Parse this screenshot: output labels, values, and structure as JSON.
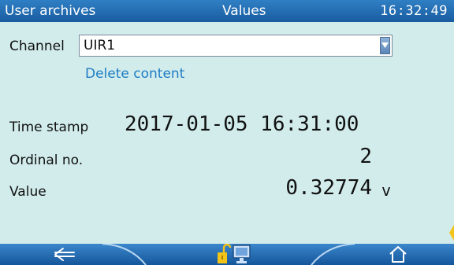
{
  "titlebar": {
    "left_title": "User archives",
    "center_title": "Values",
    "clock": "16:32:49"
  },
  "channel": {
    "label": "Channel",
    "selected_value": "UIR1"
  },
  "actions": {
    "delete_content": "Delete content"
  },
  "record": {
    "timestamp_label": "Time stamp",
    "timestamp_value": "2017-01-05 16:31:00",
    "ordinal_label": "Ordinal no.",
    "ordinal_value": "2",
    "value_label": "Value",
    "value_number": "0.32774",
    "value_unit": "v"
  },
  "bottombar": {
    "back_icon": "left-arrow-icon",
    "lock_icon": "unlocked-padlock-icon",
    "monitor_icon": "monitor-icon",
    "home_icon": "home-icon"
  },
  "colors": {
    "background": "#d2ecec",
    "bar_blue": "#1a5ca0",
    "link_blue": "#1e7dc4",
    "lock_yellow": "#f2c418"
  }
}
